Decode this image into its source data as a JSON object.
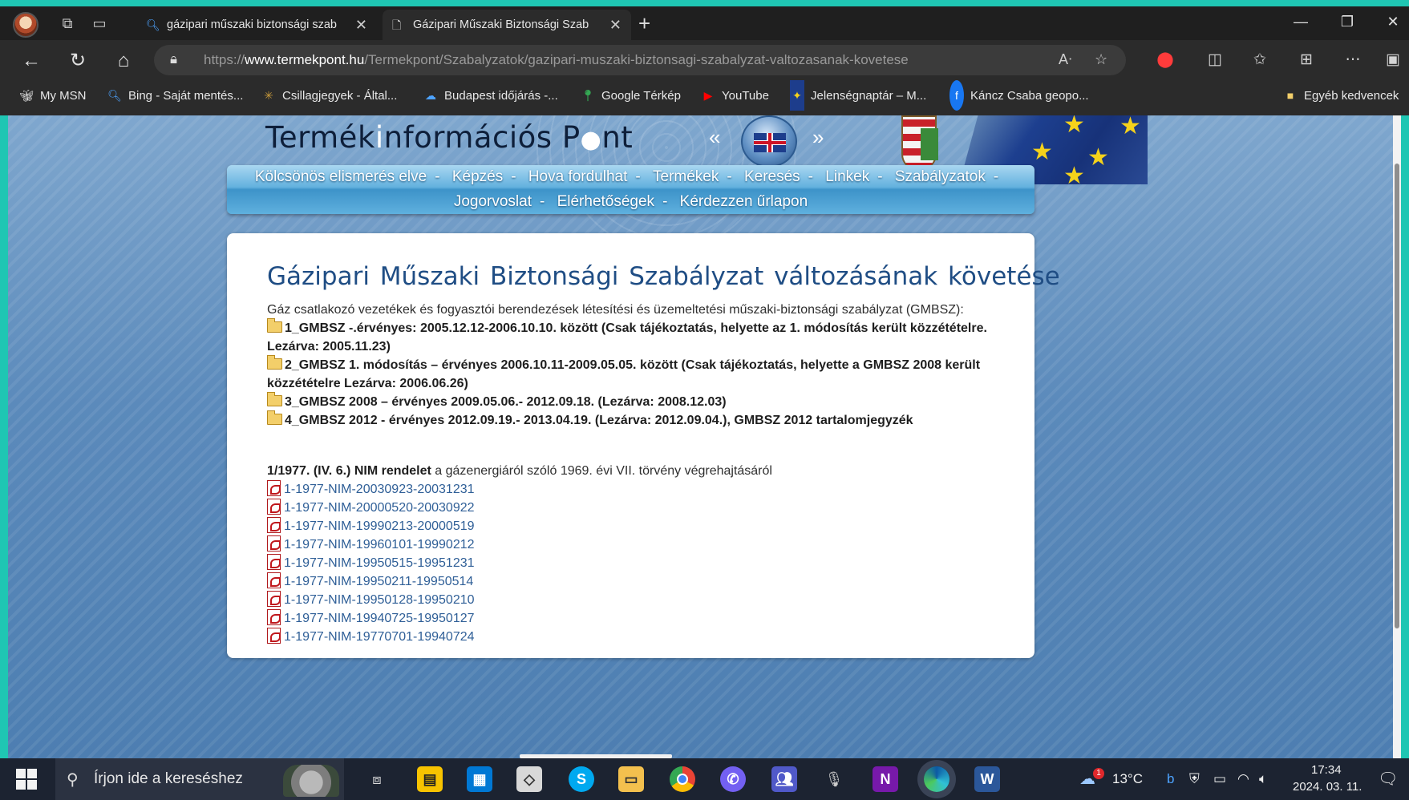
{
  "browser": {
    "tabs": [
      {
        "title": "gázipari műszaki biztonsági szab",
        "icon": "search-icon"
      },
      {
        "title": "Gázipari Műszaki Biztonsági Szab",
        "icon": "page-icon"
      }
    ],
    "url_prefix": "https://",
    "url_domain": "www.termekpont.hu",
    "url_path": "/Termekpont/Szabalyzatok/gazipari-muszaki-biztonsagi-szabalyzat-valtozasanak-kovetese",
    "favorites": [
      {
        "label": "My MSN",
        "icon": "msn-icon"
      },
      {
        "label": "Bing - Saját mentés...",
        "icon": "bing-search-icon"
      },
      {
        "label": "Csillagjegyek - Által...",
        "icon": "stars-icon"
      },
      {
        "label": "Budapest időjárás -...",
        "icon": "weather-icon"
      },
      {
        "label": "Google Térkép",
        "icon": "maps-pin-icon"
      },
      {
        "label": "YouTube",
        "icon": "youtube-icon"
      },
      {
        "label": "Jelenségnaptár – M...",
        "icon": "eu-icon"
      },
      {
        "label": "Káncz Csaba geopo...",
        "icon": "facebook-icon"
      }
    ],
    "other_favorites": "Egyéb kedvencek"
  },
  "site": {
    "logo_part1": "Termék",
    "logo_i": "i",
    "logo_part2": "nformációs P",
    "logo_dot": "●",
    "logo_part3": "nt",
    "lang_prev": "«",
    "lang_next": "»",
    "menu_row1": [
      "Kölcsönös elismerés elve",
      "Képzés",
      "Hova fordulhat",
      "Termékek",
      "Keresés",
      "Linkek",
      "Szabályzatok"
    ],
    "menu_row2": [
      "Jogorvoslat",
      "Elérhetőségek",
      "Kérdezzen űrlapon"
    ],
    "menu_sep": "-"
  },
  "content": {
    "title": "Gázipari  Műszaki  Biztonsági Szabályzat változásának követése",
    "intro": "Gáz csatlakozó vezetékek és fogyasztói berendezések létesítési és üzemeltetési műszaki-biztonsági szabályzat (GMBSZ):",
    "gmbsz": [
      "1_GMBSZ -.érvényes: 2005.12.12-2006.10.10. között (Csak tájékoztatás, helyette az 1. módosítás került közzétételre.",
      "Lezárva: 2005.11.23)",
      "2_GMBSZ 1. módosítás – érvényes 2006.10.11-2009.05.05. között (Csak tájékoztatás, helyette a GMBSZ 2008 került",
      "közzétételre Lezárva: 2006.06.26)",
      "3_GMBSZ 2008 – érvényes 2009.05.06.- 2012.09.18. (Lezárva: 2008.12.03)",
      "4_GMBSZ 2012 - érvényes 2012.09.19.- 2013.04.19. (Lezárva: 2012.09.04.), GMBSZ 2012 tartalomjegyzék"
    ],
    "nim_bold": "1/1977. (IV. 6.) NIM rendelet",
    "nim_rest": " a gázenergiáról szóló 1969. évi VII. törvény végrehajtásáról",
    "pdfs": [
      "1-1977-NIM-20030923-20031231",
      "1-1977-NIM-20000520-20030922",
      "1-1977-NIM-19990213-20000519",
      "1-1977-NIM-19960101-19990212",
      "1-1977-NIM-19950515-19951231",
      "1-1977-NIM-19950211-19950514",
      "1-1977-NIM-19950128-19950210",
      "1-1977-NIM-19940725-19950127",
      "1-1977-NIM-19770701-19940724"
    ]
  },
  "taskbar": {
    "search_placeholder": "Írjon ide a kereséshez",
    "temperature": "13°C",
    "time": "17:34",
    "date": "2024. 03. 11.",
    "notification_count": "1"
  },
  "colors": {
    "accent_link": "#2f5f97",
    "title_blue": "#1f4d84",
    "menu_blue": "#63b1de"
  }
}
